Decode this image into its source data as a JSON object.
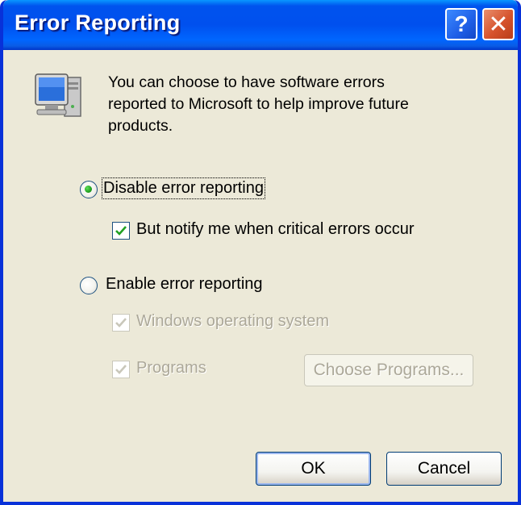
{
  "window": {
    "title": "Error Reporting",
    "help_button": "?",
    "close_button": "✕"
  },
  "intro_text": "You can choose to have software errors reported to Microsoft to help improve future products.",
  "options": {
    "disable_label": "Disable error reporting",
    "disable_selected": true,
    "notify_label": "But notify me when critical errors occur",
    "notify_checked": true,
    "enable_label": "Enable error reporting",
    "enable_selected": false,
    "windows_os_label": "Windows operating system",
    "windows_os_checked": true,
    "programs_label": "Programs",
    "programs_checked": true,
    "choose_programs_label": "Choose Programs..."
  },
  "buttons": {
    "ok_label": "OK",
    "cancel_label": "Cancel"
  },
  "colors": {
    "titlebar": "#0053ee",
    "dialog_bg": "#ece9d8",
    "disabled_text": "#aca899"
  },
  "icons": [
    "computer-icon",
    "help-icon",
    "close-icon",
    "radio-dot",
    "checkmark-icon"
  ]
}
